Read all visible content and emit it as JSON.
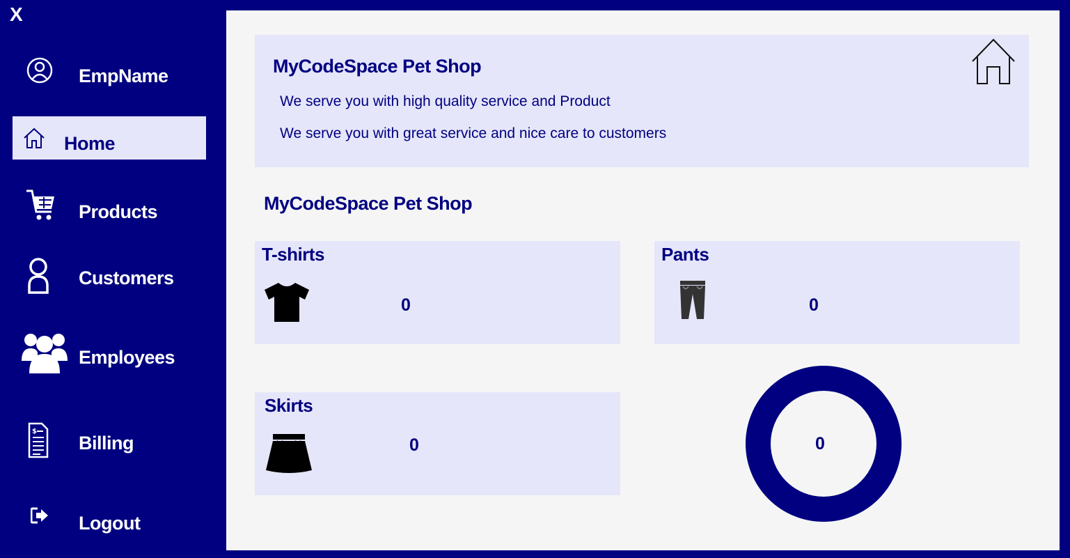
{
  "window": {
    "close_label": "X"
  },
  "sidebar": {
    "employee_name": "EmpName",
    "items": [
      {
        "label": "Home",
        "icon": "home-icon",
        "active": true
      },
      {
        "label": "Products",
        "icon": "cart-icon"
      },
      {
        "label": "Customers",
        "icon": "user-icon"
      },
      {
        "label": "Employees",
        "icon": "group-icon"
      },
      {
        "label": "Billing",
        "icon": "invoice-icon"
      },
      {
        "label": "Logout",
        "icon": "logout-icon"
      }
    ]
  },
  "header": {
    "title": "MyCodeSpace Pet Shop",
    "line1": "We serve you with high quality service and Product",
    "line2": "We serve you with great service and nice care to customers",
    "icon": "home-icon"
  },
  "section": {
    "title": "MyCodeSpace Pet Shop"
  },
  "cards": [
    {
      "title": "T-shirts",
      "count": "0",
      "icon": "tshirt-icon"
    },
    {
      "title": "Pants",
      "count": "0",
      "icon": "pants-icon"
    },
    {
      "title": "Skirts",
      "count": "0",
      "icon": "skirt-icon"
    }
  ],
  "gauge": {
    "value": "0"
  },
  "colors": {
    "navy": "#000080",
    "lavender": "#e6e6fa",
    "panel": "#f5f5f5"
  }
}
